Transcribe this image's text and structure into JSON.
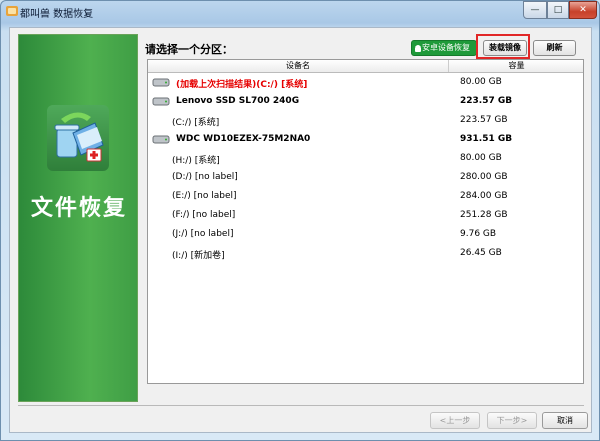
{
  "window": {
    "title": "都叫兽 数据恢复",
    "minimize": "—",
    "maximize": "□",
    "close": "✕"
  },
  "sidebar": {
    "label": "文件恢复"
  },
  "main": {
    "prompt": "请选择一个分区：",
    "buttons": {
      "android": "安卓设备恢复",
      "mount": "装载镜像",
      "refresh": "刷新"
    },
    "columns": {
      "name": "设备名",
      "capacity": "容量"
    },
    "rows": [
      {
        "type": "scan",
        "name": "(加载上次扫描结果)(C:/) [系统]",
        "capacity": "80.00 GB"
      },
      {
        "type": "disk",
        "name": "Lenovo SSD SL700 240G",
        "capacity": "223.57 GB"
      },
      {
        "type": "partition",
        "name": "(C:/) [系统]",
        "capacity": "223.57 GB"
      },
      {
        "type": "disk",
        "name": "WDC WD10EZEX-75M2NA0",
        "capacity": "931.51 GB"
      },
      {
        "type": "partition",
        "name": "(H:/) [系统]",
        "capacity": "80.00 GB"
      },
      {
        "type": "partition",
        "name": "(D:/) [no label]",
        "capacity": "280.00 GB"
      },
      {
        "type": "partition",
        "name": "(E:/) [no label]",
        "capacity": "284.00 GB"
      },
      {
        "type": "partition",
        "name": "(F:/) [no label]",
        "capacity": "251.28 GB"
      },
      {
        "type": "partition",
        "name": "(J:/) [no label]",
        "capacity": "9.76 GB"
      },
      {
        "type": "partition",
        "name": "(I:/) [新加卷]",
        "capacity": "26.45 GB"
      }
    ]
  },
  "footer": {
    "prev": "<上一步",
    "next": "下一步>",
    "cancel": "取消"
  },
  "colors": {
    "accent_green": "#2d8a3a",
    "highlight_red": "#e12727",
    "scan_text_red": "#e60000"
  },
  "icons": [
    "app-icon",
    "recycle-bin-icon",
    "folder-icon",
    "android-icon",
    "disk-drive-icon",
    "pointer-arrow-icon"
  ]
}
